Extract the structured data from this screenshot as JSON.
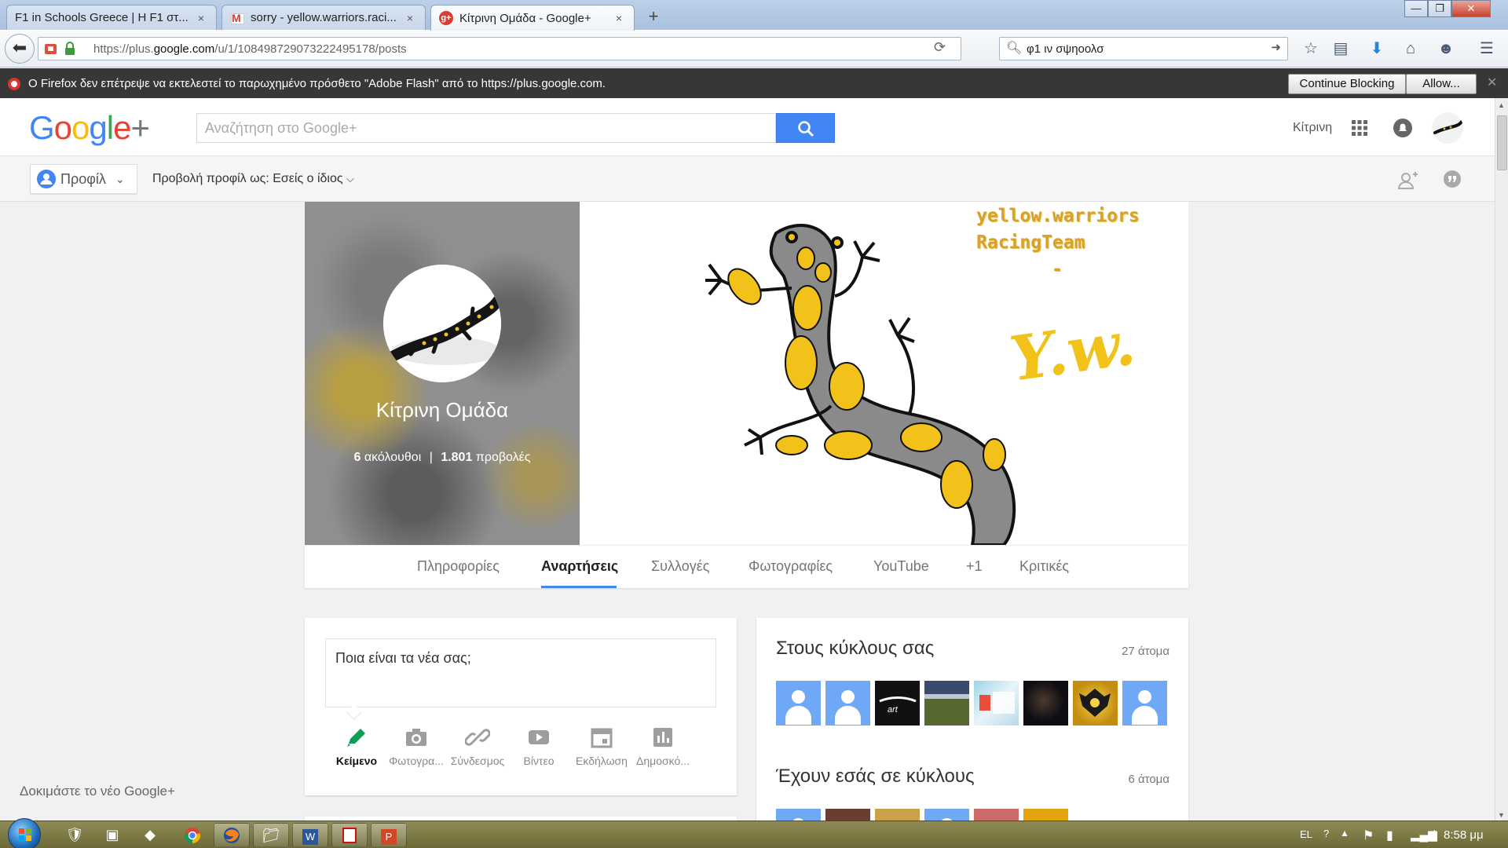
{
  "browser": {
    "tabs": [
      {
        "title": "F1 in Schools Greece | Η F1 στ...",
        "close": "×"
      },
      {
        "title": "sorry - yellow.warriors.raci...",
        "close": "×"
      },
      {
        "title": "Κίτρινη Ομάδα - Google+",
        "close": "×"
      }
    ],
    "new_tab": "+",
    "window_controls": {
      "minimize": "—",
      "maximize": "❐",
      "close": "✕"
    },
    "url_host_prefix": "https://plus.",
    "url_domain": "google.com",
    "url_path": "/u/1/108498729073222495178/posts",
    "search_value": "φ1 ιν σψηοολσ",
    "icons": [
      "back-icon",
      "home-icon",
      "bookmark-star-icon",
      "reading-list-icon",
      "download-icon",
      "chat-icon",
      "menu-icon"
    ]
  },
  "flash": {
    "message": "O Firefox δεν επέτρεψε να εκτελεστεί το παρωχημένο πρόσθετο \"Adobe Flash\" από το https://plus.google.com.",
    "continue_blocking": "Continue Blocking",
    "allow": "Allow..."
  },
  "gplus": {
    "logo": "Google+",
    "search_placeholder": "Αναζήτηση στο Google+",
    "username": "Κίτρινη"
  },
  "subheader": {
    "profile_label": "Προφίλ",
    "view_as": "Προβολή προφίλ ως: Εσείς ο ίδιος"
  },
  "profile": {
    "name": "Κίτρινη Ομάδα",
    "followers_count": "6",
    "followers_label": "ακόλουθοι",
    "views_count": "1.801",
    "views_label": "προβολές",
    "separator": "|",
    "cover_caption_line1": "yellow.warriors",
    "cover_caption_line2": "RacingTeam",
    "cover_caption_line3": "-",
    "cover_signature": "Y.w."
  },
  "profile_tabs": [
    "Πληροφορίες",
    "Αναρτήσεις",
    "Συλλογές",
    "Φωτογραφίες",
    "YouTube",
    "+1",
    "Κριτικές"
  ],
  "share": {
    "prompt": "Ποια είναι τα νέα σας;",
    "actions": [
      "Κείμενο",
      "Φωτογρα...",
      "Σύνδεσμος",
      "Βίντεο",
      "Εκδήλωση",
      "Δημοσκό..."
    ]
  },
  "circles": {
    "in_your_circles_title": "Στους κύκλους σας",
    "in_your_circles_count": "27 άτομα",
    "have_you_title": "Έχουν εσάς σε κύκλους",
    "have_you_count": "6 άτομα"
  },
  "promo": {
    "try_new": "Δοκιμάστε το νέο Google+"
  },
  "taskbar": {
    "language": "EL",
    "clock": "8:58 μμ"
  },
  "colors": {
    "accent_blue": "#4285f4",
    "flash_bar": "#373737",
    "salamander_yellow": "#f2c21b",
    "taskbar": "#7a7744"
  }
}
